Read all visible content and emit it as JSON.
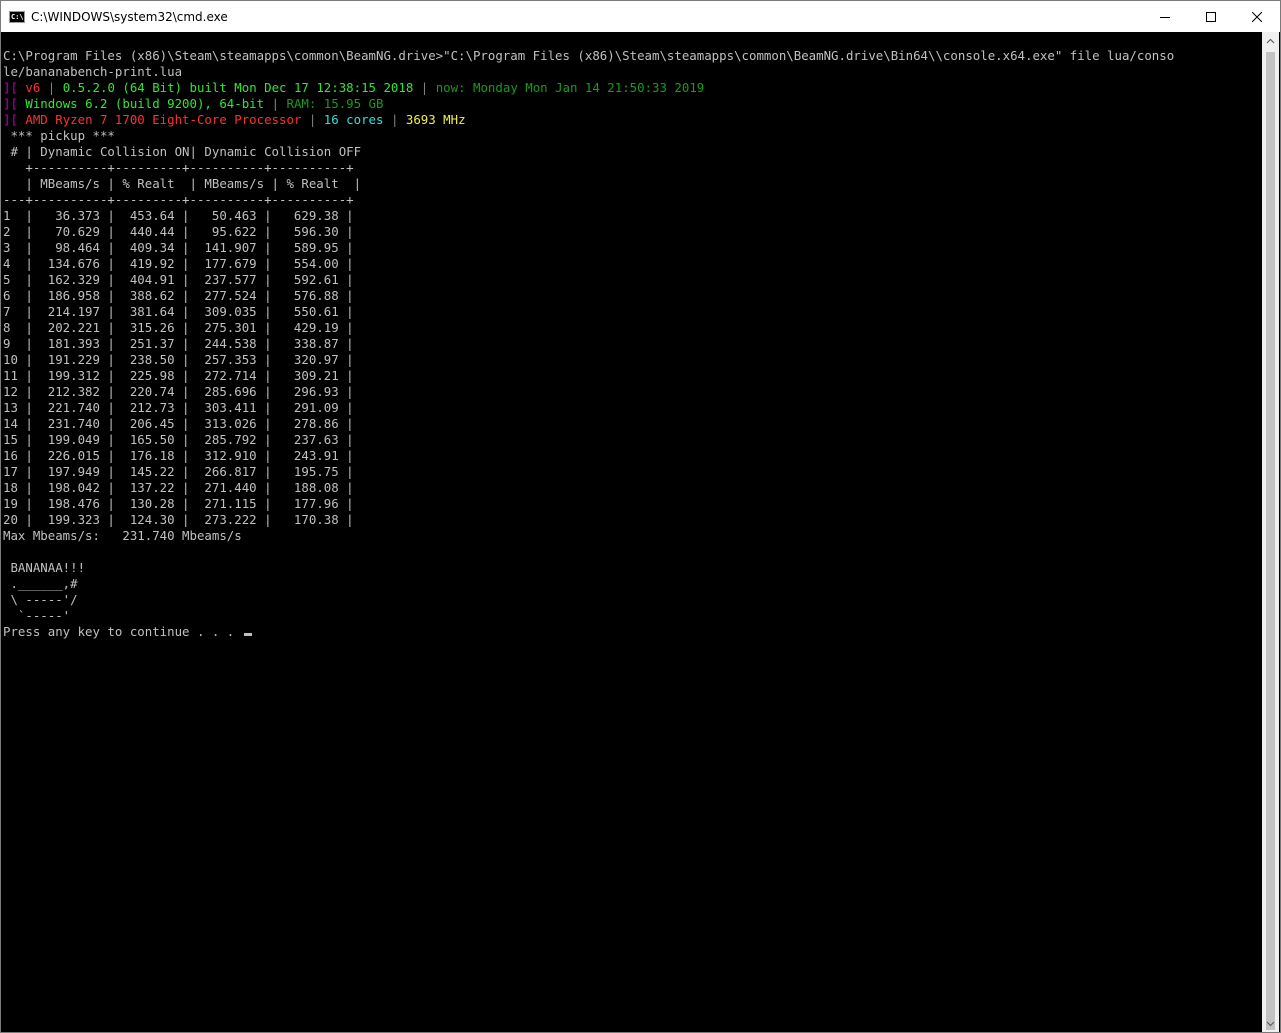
{
  "window": {
    "title": "C:\\WINDOWS\\system32\\cmd.exe",
    "icon_label": "C:\\",
    "controls": [
      "minimize-icon",
      "maximize-icon",
      "close-icon"
    ]
  },
  "console": {
    "command_line_1": "C:\\Program Files (x86)\\Steam\\steamapps\\common\\BeamNG.drive>\"C:\\Program Files (x86)\\Steam\\steamapps\\common\\BeamNG.drive\\Bin64\\\\console.x64.exe\" file lua/conso",
    "command_line_2": "le/bananabench-print.lua",
    "info_lines": [
      [
        {
          "t": "][ ",
          "c": "magenta"
        },
        {
          "t": "v6",
          "c": "red"
        },
        {
          "t": " | ",
          "c": "grey"
        },
        {
          "t": "0.5.2.0 (64 Bit) built Mon Dec 17 12:38:15 2018",
          "c": "lgreen"
        },
        {
          "t": " | ",
          "c": "grey"
        },
        {
          "t": "now: Monday Mon Jan 14 21:50:33 2019",
          "c": "dgreen"
        }
      ],
      [
        {
          "t": "][ ",
          "c": "magenta"
        },
        {
          "t": "Windows 6.2 (build 9200), 64-bit",
          "c": "lgreen"
        },
        {
          "t": " | ",
          "c": "grey"
        },
        {
          "t": "RAM: 15.95 GB",
          "c": "dgreen"
        }
      ],
      [
        {
          "t": "][ ",
          "c": "magenta"
        },
        {
          "t": "AMD Ryzen 7 1700 Eight-Core Processor",
          "c": "red"
        },
        {
          "t": " | ",
          "c": "grey"
        },
        {
          "t": "16 cores",
          "c": "cyan"
        },
        {
          "t": " | ",
          "c": "grey"
        },
        {
          "t": "3693 MHz",
          "c": "yellow"
        }
      ]
    ],
    "vehicle_header": " *** pickup ***",
    "table": {
      "header_line": " # | Dynamic Collision ON| Dynamic Collision OFF",
      "sep_line_1": "   +----------+---------+----------+----------+",
      "subheader_line": "   | MBeams/s | % Realt  | MBeams/s | % Realt  |",
      "sep_line_2": "---+----------+---------+----------+----------+",
      "rows": [
        [
          "1",
          "36.373",
          "453.64",
          "50.463",
          "629.38"
        ],
        [
          "2",
          "70.629",
          "440.44",
          "95.622",
          "596.30"
        ],
        [
          "3",
          "98.464",
          "409.34",
          "141.907",
          "589.95"
        ],
        [
          "4",
          "134.676",
          "419.92",
          "177.679",
          "554.00"
        ],
        [
          "5",
          "162.329",
          "404.91",
          "237.577",
          "592.61"
        ],
        [
          "6",
          "186.958",
          "388.62",
          "277.524",
          "576.88"
        ],
        [
          "7",
          "214.197",
          "381.64",
          "309.035",
          "550.61"
        ],
        [
          "8",
          "202.221",
          "315.26",
          "275.301",
          "429.19"
        ],
        [
          "9",
          "181.393",
          "251.37",
          "244.538",
          "338.87"
        ],
        [
          "10",
          "191.229",
          "238.50",
          "257.353",
          "320.97"
        ],
        [
          "11",
          "199.312",
          "225.98",
          "272.714",
          "309.21"
        ],
        [
          "12",
          "212.382",
          "220.74",
          "285.696",
          "296.93"
        ],
        [
          "13",
          "221.740",
          "212.73",
          "303.411",
          "291.09"
        ],
        [
          "14",
          "231.740",
          "206.45",
          "313.026",
          "278.86"
        ],
        [
          "15",
          "199.049",
          "165.50",
          "285.792",
          "237.63"
        ],
        [
          "16",
          "226.015",
          "176.18",
          "312.910",
          "243.91"
        ],
        [
          "17",
          "197.949",
          "145.22",
          "266.817",
          "195.75"
        ],
        [
          "18",
          "198.042",
          "137.22",
          "271.440",
          "188.08"
        ],
        [
          "19",
          "198.476",
          "130.28",
          "271.115",
          "177.96"
        ],
        [
          "20",
          "199.323",
          "124.30",
          "273.222",
          "170.38"
        ]
      ]
    },
    "max_line": "Max Mbeams/s:   231.740 Mbeams/s",
    "blank_line": "",
    "banana_art": [
      " BANANAA!!!",
      " .______,#",
      " \\ -----'/",
      "  `-----'"
    ],
    "prompt": "Press any key to continue . . . "
  }
}
